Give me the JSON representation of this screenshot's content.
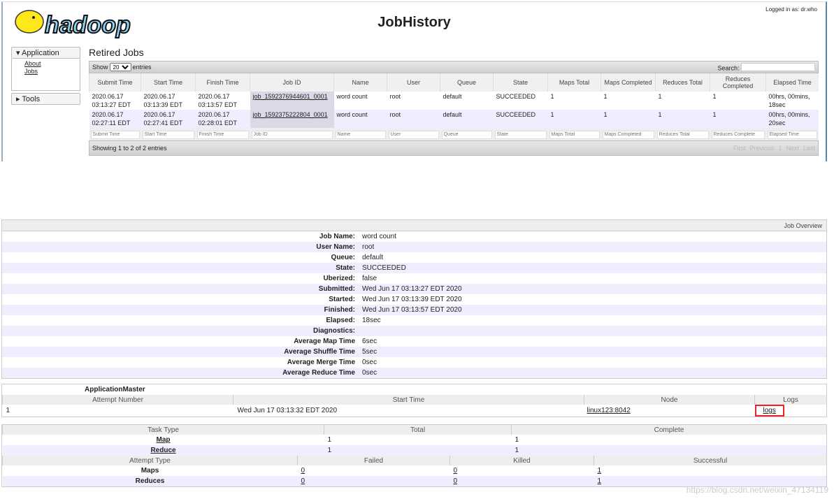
{
  "header": {
    "logo_text": "hadoop",
    "title": "JobHistory",
    "login": "Logged in as: dr.who"
  },
  "nav": {
    "application": "Application",
    "items": [
      "About",
      "Jobs"
    ],
    "tools": "Tools"
  },
  "retired": {
    "title": "Retired Jobs",
    "show": "Show",
    "entries_value": "20",
    "entries": "entries",
    "search": "Search:",
    "columns": [
      "Submit Time",
      "Start Time",
      "Finish Time",
      "Job ID",
      "Name",
      "User",
      "Queue",
      "State",
      "Maps Total",
      "Maps Completed",
      "Reduces Total",
      "Reduces Completed",
      "Elapsed Time"
    ],
    "rows": [
      [
        "2020.06.17 03:13:27 EDT",
        "2020.06.17 03:13:39 EDT",
        "2020.06.17 03:13:57 EDT",
        "job_1592376944601_0001",
        "word count",
        "root",
        "default",
        "SUCCEEDED",
        "1",
        "1",
        "1",
        "1",
        "00hrs, 00mins, 18sec"
      ],
      [
        "2020.06.17 02:27:11 EDT",
        "2020.06.17 02:27:41 EDT",
        "2020.06.17 02:28:01 EDT",
        "job_1592375222804_0001",
        "word count",
        "root",
        "default",
        "SUCCEEDED",
        "1",
        "1",
        "1",
        "1",
        "00hrs, 00mins, 20sec"
      ]
    ],
    "filters": [
      "Submit Time",
      "Start Time",
      "Finish Time",
      "Job ID",
      "Name",
      "User",
      "Queue",
      "State",
      "Maps Total",
      "Maps Completed",
      "Reduces Total",
      "Reduces Complete",
      "Elapsed Time"
    ],
    "info": "Showing 1 to 2 of 2 entries",
    "pager": [
      "First",
      "Previous",
      "1",
      "Next",
      "Last"
    ]
  },
  "overview": {
    "title": "Job Overview",
    "rows": [
      [
        "Job Name:",
        "word count"
      ],
      [
        "User Name:",
        "root"
      ],
      [
        "Queue:",
        "default"
      ],
      [
        "State:",
        "SUCCEEDED"
      ],
      [
        "Uberized:",
        "false"
      ],
      [
        "Submitted:",
        "Wed Jun 17 03:13:27 EDT 2020"
      ],
      [
        "Started:",
        "Wed Jun 17 03:13:39 EDT 2020"
      ],
      [
        "Finished:",
        "Wed Jun 17 03:13:57 EDT 2020"
      ],
      [
        "Elapsed:",
        "18sec"
      ],
      [
        "Diagnostics:",
        ""
      ],
      [
        "Average Map Time",
        "6sec"
      ],
      [
        "Average Shuffle Time",
        "5sec"
      ],
      [
        "Average Merge Time",
        "0sec"
      ],
      [
        "Average Reduce Time",
        "0sec"
      ]
    ]
  },
  "am": {
    "title": "ApplicationMaster",
    "columns": [
      "Attempt Number",
      "Start Time",
      "Node",
      "Logs"
    ],
    "row": [
      "1",
      "Wed Jun 17 03:13:32 EDT 2020",
      "linux123:8042",
      "logs"
    ]
  },
  "tasks": {
    "columns": [
      "Task Type",
      "Total",
      "Complete"
    ],
    "rows": [
      [
        "Map",
        "1",
        "1"
      ],
      [
        "Reduce",
        "1",
        "1"
      ]
    ]
  },
  "attempts": {
    "columns": [
      "Attempt Type",
      "Failed",
      "Killed",
      "Successful"
    ],
    "rows": [
      [
        "Maps",
        "0",
        "0",
        "1"
      ],
      [
        "Reduces",
        "0",
        "0",
        "1"
      ]
    ]
  },
  "watermark": "https://blog.csdn.net/weixin_47134119"
}
